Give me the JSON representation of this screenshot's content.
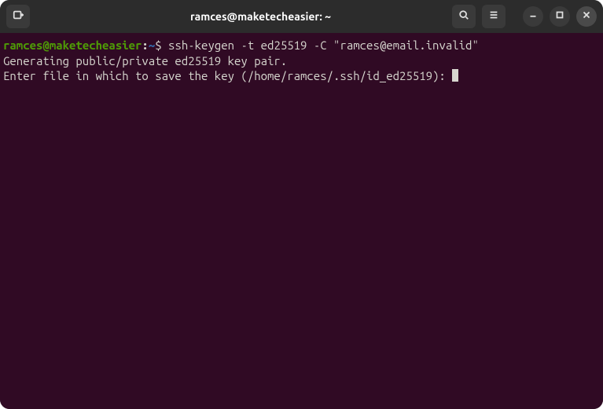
{
  "window": {
    "title": "ramces@maketecheasier: ~"
  },
  "prompt": {
    "user": "ramces",
    "at": "@",
    "host": "maketecheasier",
    "colon": ":",
    "path": "~",
    "dollar": "$"
  },
  "terminal": {
    "command": "ssh-keygen -t ed25519 -C \"ramces@email.invalid\"",
    "line1": "Generating public/private ed25519 key pair.",
    "line2": "Enter file in which to save the key (/home/ramces/.ssh/id_ed25519): "
  },
  "icons": {
    "newtab": "new-tab-icon",
    "search": "search-icon",
    "menu": "hamburger-menu-icon",
    "minimize": "minimize-icon",
    "maximize": "maximize-icon",
    "close": "close-icon"
  }
}
